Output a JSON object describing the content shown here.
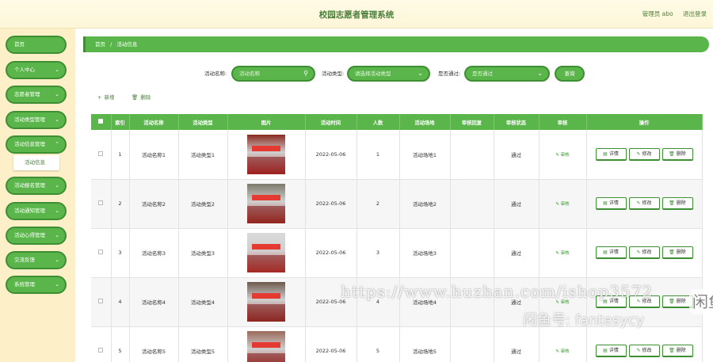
{
  "header": {
    "title": "校园志愿者管理系统",
    "user": "管理员 abo",
    "logout": "退出登录"
  },
  "sidebar": {
    "items": [
      {
        "label": "首页"
      },
      {
        "label": "个人中心"
      },
      {
        "label": "志愿者管理"
      },
      {
        "label": "活动类型管理"
      },
      {
        "label": "活动信息管理"
      },
      {
        "label": "活动报名管理"
      },
      {
        "label": "活动通知管理"
      },
      {
        "label": "活动心得管理"
      },
      {
        "label": "交流反馈"
      },
      {
        "label": "系统管理"
      }
    ],
    "sub_item": "活动信息"
  },
  "breadcrumb": {
    "home": "首页",
    "sep": "/",
    "current": "活动信息"
  },
  "search": {
    "name_label": "活动名称:",
    "name_placeholder": "活动名称",
    "type_label": "活动类型:",
    "type_placeholder": "请选择活动类型",
    "pass_label": "是否通过:",
    "pass_placeholder": "是否通过",
    "query": "查询"
  },
  "actions": {
    "add": "新增",
    "delete": "删除"
  },
  "table": {
    "headers": [
      "",
      "索引",
      "活动名称",
      "活动类型",
      "图片",
      "活动时间",
      "人数",
      "活动场地",
      "审核回复",
      "审核状态",
      "审核",
      "操作"
    ],
    "rows": [
      {
        "index": "1",
        "name": "活动名称1",
        "type": "活动类型1",
        "date": "2022-05-06",
        "people": "1",
        "venue": "活动场地1",
        "reply": "",
        "status": "通过",
        "audit": "审核"
      },
      {
        "index": "2",
        "name": "活动名称2",
        "type": "活动类型2",
        "date": "2022-05-06",
        "people": "2",
        "venue": "活动场地2",
        "reply": "",
        "status": "通过",
        "audit": "审核"
      },
      {
        "index": "3",
        "name": "活动名称3",
        "type": "活动类型3",
        "date": "2022-05-06",
        "people": "3",
        "venue": "活动场地3",
        "reply": "",
        "status": "通过",
        "audit": "审核"
      },
      {
        "index": "4",
        "name": "活动名称4",
        "type": "活动类型4",
        "date": "2022-05-06",
        "people": "4",
        "venue": "活动场地4",
        "reply": "",
        "status": "通过",
        "audit": "审核"
      },
      {
        "index": "5",
        "name": "活动名称5",
        "type": "活动类型5",
        "date": "2022-05-06",
        "people": "5",
        "venue": "活动场地5",
        "reply": "",
        "status": "通过",
        "audit": "审核"
      }
    ],
    "ops": {
      "detail": "详情",
      "edit": "修改",
      "delete": "删除"
    }
  },
  "watermark": {
    "url": "https://www.huzhan.com/ishop3572",
    "id": "闲鱼号: fantesycy",
    "logo": "闲鱼"
  },
  "colors": {
    "green": "#5ab64a",
    "green_dark": "#3e8f33",
    "sidebar_bg": "#fdf0c8",
    "header_bg": "#fffbe6"
  },
  "icons": {
    "search": "search-icon",
    "chevron": "chevron-down-icon",
    "add": "plus-icon",
    "delete": "trash-icon",
    "edit": "edit-icon",
    "detail": "detail-icon"
  }
}
